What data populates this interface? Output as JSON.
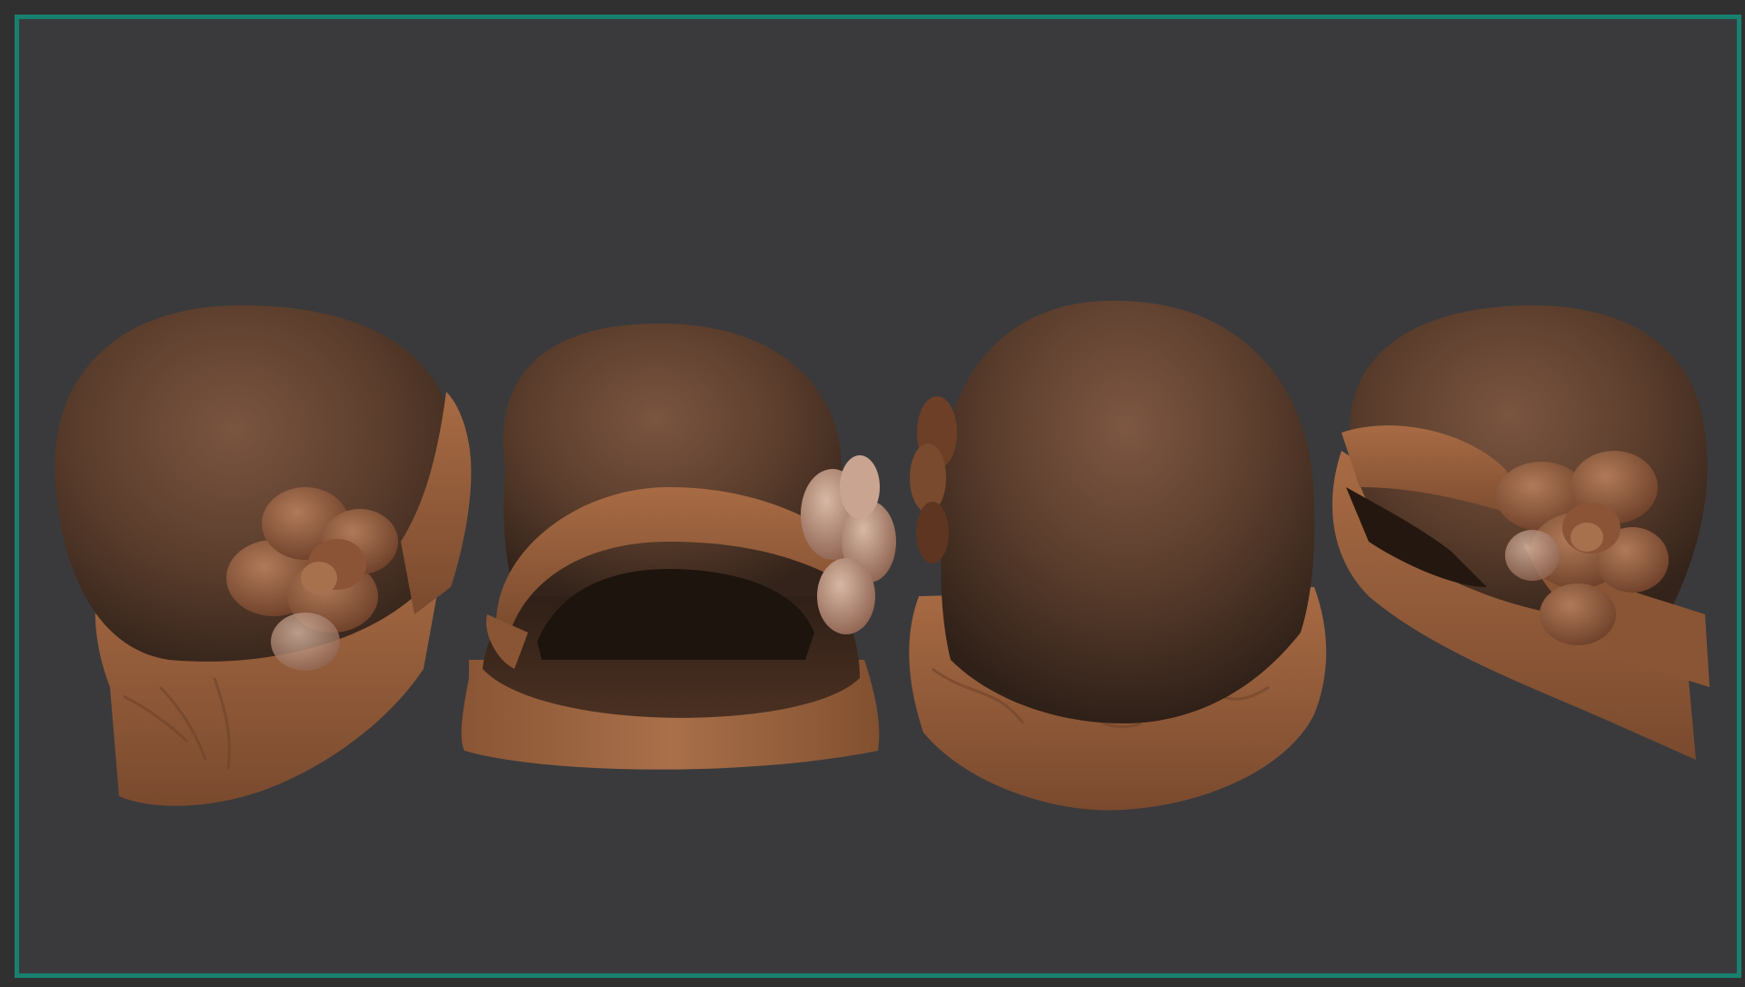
{
  "scene": {
    "subject": "cloche-hat-turnaround",
    "views": [
      {
        "id": "left-side",
        "icon": "hat-left-view-icon"
      },
      {
        "id": "front",
        "icon": "hat-front-view-icon"
      },
      {
        "id": "back",
        "icon": "hat-back-view-icon"
      },
      {
        "id": "right-three-quarter",
        "icon": "hat-right-view-icon"
      }
    ],
    "colors": {
      "background": "#3a3a3c",
      "frame_border": "#18806f",
      "felt_dark": "#4a3226",
      "felt_mid": "#6b4834",
      "brim": "#9a623e",
      "flower": "#8a5638"
    }
  }
}
